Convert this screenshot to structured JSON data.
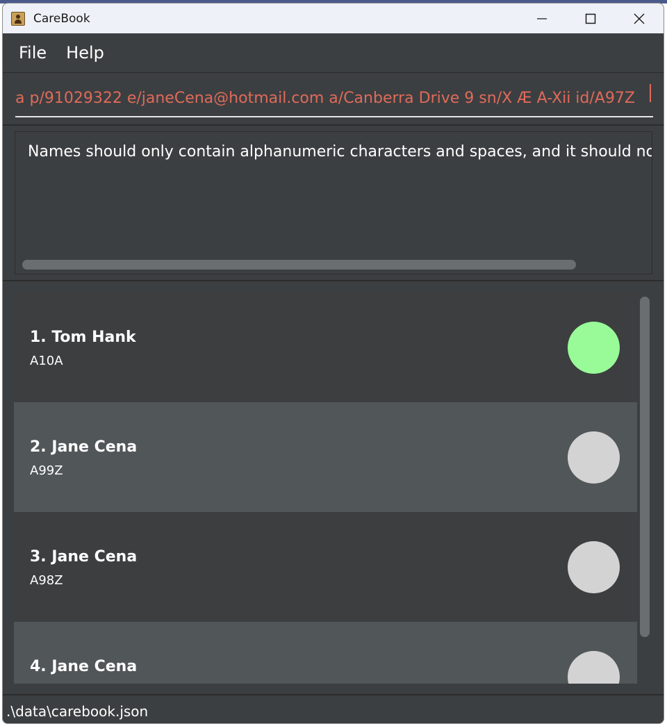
{
  "window": {
    "title": "CareBook",
    "controls": {
      "minimize_icon": "minimize-icon",
      "maximize_icon": "maximize-icon",
      "close_icon": "close-icon"
    }
  },
  "menu": {
    "items": [
      {
        "label": "File"
      },
      {
        "label": "Help"
      }
    ]
  },
  "command_box": {
    "value": "a p/91029322 e/janeCena@hotmail.com a/Canberra Drive 9 sn/X Æ A-Xii id/A97Z",
    "text_color": "#e06a5a"
  },
  "result_display": {
    "message": "Names should only contain alphanumeric characters and spaces, and it should not"
  },
  "persons": [
    {
      "index_name": "1. Tom Hank",
      "id": "A10A",
      "status_color": "#98fb98"
    },
    {
      "index_name": "2. Jane Cena",
      "id": "A99Z",
      "status_color": "#d3d3d3"
    },
    {
      "index_name": "3. Jane Cena",
      "id": "A98Z",
      "status_color": "#d3d3d3"
    },
    {
      "index_name": "4. Jane Cena",
      "id": "",
      "status_color": "#d3d3d3"
    }
  ],
  "status_bar": {
    "path": ".\\data\\carebook.json"
  },
  "colors": {
    "background": "#3c3f41",
    "card_alt": "#515658",
    "status_green": "#98fb98",
    "status_grey": "#d3d3d3"
  }
}
